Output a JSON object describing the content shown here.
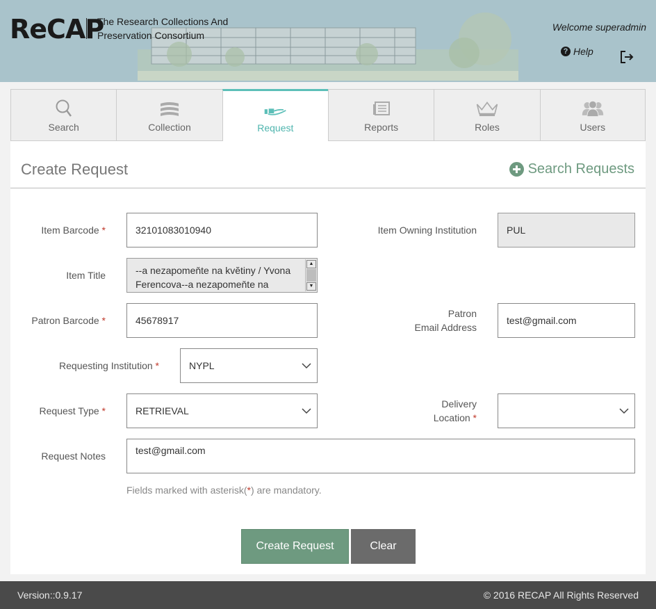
{
  "header": {
    "logo": "ReCAP",
    "tagline": "The Research Collections And Preservation Consortium",
    "welcome": "Welcome superadmin",
    "help_label": "Help"
  },
  "tabs": [
    {
      "label": "Search",
      "icon": "search-icon"
    },
    {
      "label": "Collection",
      "icon": "books-icon"
    },
    {
      "label": "Request",
      "icon": "hand-book-icon",
      "active": true
    },
    {
      "label": "Reports",
      "icon": "report-icon"
    },
    {
      "label": "Roles",
      "icon": "crown-icon"
    },
    {
      "label": "Users",
      "icon": "users-icon"
    }
  ],
  "page": {
    "title": "Create Request",
    "search_requests_label": "Search Requests"
  },
  "form": {
    "item_barcode": {
      "label": "Item Barcode",
      "value": "32101083010940"
    },
    "item_owning_institution": {
      "label": "Item Owning Institution",
      "value": "PUL"
    },
    "item_title": {
      "label": "Item Title",
      "value": "--a nezapomeňte na kvĕtiny / Yvona Ferencova--a nezapomeňte na kvĕtiny"
    },
    "patron_barcode": {
      "label": "Patron Barcode",
      "value": "45678917"
    },
    "patron_email": {
      "label_line1": "Patron",
      "label_line2": "Email Address",
      "value": "test@gmail.com"
    },
    "requesting_institution": {
      "label": "Requesting Institution",
      "value": "NYPL"
    },
    "request_type": {
      "label": "Request Type",
      "value": "RETRIEVAL"
    },
    "delivery_location": {
      "label_line1": "Delivery",
      "label_line2": "Location",
      "value": ""
    },
    "request_notes": {
      "label": "Request Notes",
      "value": "test@gmail.com"
    },
    "required_mark": "*",
    "hint_before": "Fields marked with asterisk(",
    "hint_after": ") are mandatory."
  },
  "buttons": {
    "create": "Create Request",
    "clear": "Clear"
  },
  "footer": {
    "version": "Version::0.9.17",
    "copyright": "© 2016 RECAP All Rights Reserved"
  },
  "colors": {
    "header_bg": "#a9c3cb",
    "accent_teal": "#5cbfb8",
    "green": "#6e9a80",
    "required": "#c0392b",
    "footer_bg": "#4a4a4a"
  }
}
